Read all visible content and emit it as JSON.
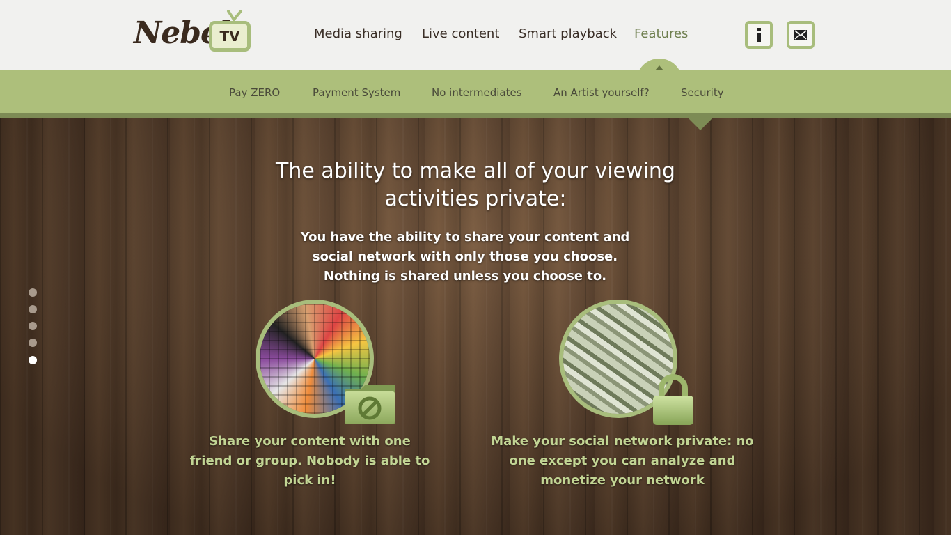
{
  "brand": {
    "name": "Nebel.",
    "tv": "TV"
  },
  "main_nav": {
    "items": [
      {
        "label": "Media sharing"
      },
      {
        "label": "Live content"
      },
      {
        "label": "Smart playback"
      },
      {
        "label": "Features",
        "active": true
      }
    ]
  },
  "header_icons": {
    "info": "info-icon",
    "mail": "mail-icon"
  },
  "sub_nav": {
    "items": [
      {
        "label": "Pay ZERO"
      },
      {
        "label": "Payment System"
      },
      {
        "label": "No intermediates"
      },
      {
        "label": "An Artist yourself?"
      },
      {
        "label": "Security",
        "active": true
      }
    ]
  },
  "slide": {
    "headline": "The ability to make all of your viewing activities private:",
    "subtext": "You have the ability to share your content and social network with only those you choose. Nothing is shared unless you choose to.",
    "features": [
      {
        "caption": "Share your content with one friend or group. Nobody is able to pick in!",
        "badge": "folder-block-icon"
      },
      {
        "caption": "Make your social network private: no one except you can analyze and monetize your network",
        "badge": "padlock-icon"
      }
    ]
  },
  "pager": {
    "count": 5,
    "active_index": 4
  },
  "colors": {
    "accent": "#adbf7b",
    "accent_dark": "#7d8b55",
    "caption": "#c2d594"
  }
}
